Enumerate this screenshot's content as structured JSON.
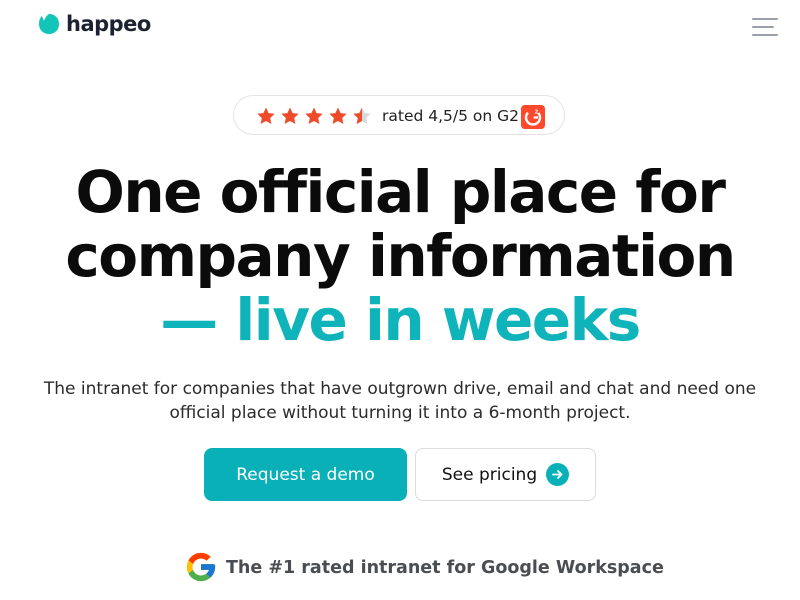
{
  "brand": {
    "name": "happeo",
    "mark_color": "#13c5b8"
  },
  "header": {
    "menu_icon": "hamburger-menu-icon"
  },
  "rating": {
    "stars": 4.5,
    "star_color": "#ee4b2b",
    "text": "rated 4,5/5 on G2",
    "badge_icon": "g2-logo-icon"
  },
  "hero": {
    "headline_line1": "One official place for",
    "headline_line2": "company information",
    "headline_line3": "— live in weeks",
    "accent_color": "#0fb3ba",
    "subtitle_line1": "The intranet for companies that have outgrown drive, email and chat and need one",
    "subtitle_line2": "official place without turning it into a 6-month project."
  },
  "cta": {
    "demo_label": "Request a demo",
    "pricing_label": "See pricing",
    "pricing_icon": "arrow-right-icon",
    "primary_color": "#0ab0b8"
  },
  "trust": {
    "icon": "google-logo-icon",
    "text": "The #1 rated intranet for Google Workspace"
  }
}
